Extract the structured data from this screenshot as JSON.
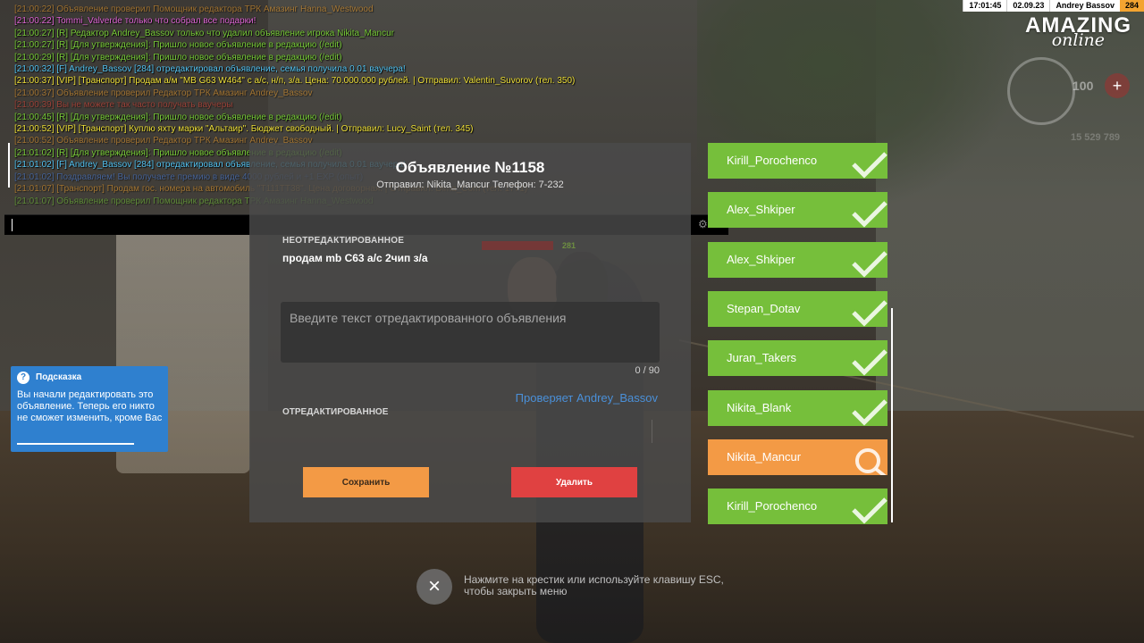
{
  "chat": [
    {
      "text": "[21:00:22] Объявление проверил Помощник редактора ТРК Амазинг Hanna_Westwood",
      "color": "#f4a431",
      "dim": true
    },
    {
      "text": "[21:00:22] Tommi_Valverde только что собрал все подарки!",
      "color": "#e36ad9",
      "dim": false
    },
    {
      "text": "[21:00:27] [R] Редактор Andrey_Bassov только что удалил объявление игрока Nikita_Mancur",
      "color": "#7ccf3c",
      "dim": false
    },
    {
      "text": "[21:00:27] [R] [Для утверждения]: Пришло новое объявление в редакцию (/edit)",
      "color": "#7ccf3c",
      "dim": false
    },
    {
      "text": "[21:00:29] [R] [Для утверждения]: Пришло новое объявление в редакцию (/edit)",
      "color": "#7ccf3c",
      "dim": false
    },
    {
      "text": "[21:00:32] [F] Andrey_Bassov [284] отредактировал объявление, семья получила 0.01 ваучера!",
      "color": "#58c7f5",
      "dim": false
    },
    {
      "text": "[21:00:37] [VIP] [Транспорт] Продам а/м \"MB G63 W464\" с а/с, н/п, з/а. Цена: 70.000.000 рублей. | Отправил: Valentin_Suvorov (тел. 350)",
      "color": "#f2e33c",
      "dim": false
    },
    {
      "text": "[21:00:37] Объявление проверил Редактор ТРК Амазинг Andrey_Bassov",
      "color": "#f4a431",
      "dim": true
    },
    {
      "text": "[21:00:39] Вы не можете так часто получать ваучеры",
      "color": "#e84a3c",
      "dim": true
    },
    {
      "text": "[21:00:45] [R] [Для утверждения]: Пришло новое объявление в редакцию (/edit)",
      "color": "#7ccf3c",
      "dim": false
    },
    {
      "text": "[21:00:52] [VIP] [Транспорт] Куплю яхту марки \"Альтаир\". Бюджет свободный. | Отправил: Lucy_Saint (тел. 345)",
      "color": "#f2e33c",
      "dim": false
    },
    {
      "text": "[21:00:52] Объявление проверил Редактор ТРК Амазинг Andrey_Bassov",
      "color": "#f4a431",
      "dim": true
    },
    {
      "text": "[21:01:02] [R] [Для утверждения]: Пришло новое объявление в редакцию (/edit)",
      "color": "#7ccf3c",
      "dim": false
    },
    {
      "text": "[21:01:02] [F] Andrey_Bassov [284] отредактировал объявление, семья получила 0.01 ваучера!",
      "color": "#58c7f5",
      "dim": false
    },
    {
      "text": "[21:01:02] Поздравляем! Вы получаете премию в виде 4000 рублей и +1 EXP (опыт)",
      "color": "#4f86e8",
      "dim": true
    },
    {
      "text": "[21:01:07] [Транспорт] Продам гос. номера на автомобиль \"Т111ТТ38\". Цена договорная. | Отправил: Dima_Com (тел. 1771)",
      "color": "#f4a431",
      "dim": true
    },
    {
      "text": "[21:01:07] Объявление проверил Помощник редактора ТРК Амазинг Hanna_Westwood",
      "color": "#7ccf3c",
      "dim": true
    }
  ],
  "chat_input": {
    "lang": "RU",
    "gear_icon": "gear-icon"
  },
  "hud": {
    "time": "17:01:45",
    "date": "02.09.23",
    "player": "Andrey Bassov",
    "id": "284",
    "logo_main": "AMAZING",
    "logo_sub": "online",
    "hp": "100",
    "plus": "+",
    "money": "15 529 789"
  },
  "hint": {
    "title": "Подсказка",
    "text": "Вы начали редактировать это объявление. Теперь его никто не сможет изменить, кроме Вас",
    "icon": "?"
  },
  "modal": {
    "title": "Объявление №1158",
    "subtitle": "Отправил: Nikita_Mancur Телефон: 7-232",
    "label_original": "НЕОТРЕДАКТИРОВАННОЕ",
    "original_text": "продам mb C63 а/с 2чип з/а",
    "placeholder": "Введите текст отредактированного объявления",
    "counter": "0 / 90",
    "checker": "Проверяет Andrey_Bassov",
    "label_edited": "ОТРЕДАКТИРОВАННОЕ",
    "save_label": "Сохранить",
    "delete_label": "Удалить",
    "hp_num": "281"
  },
  "editors": [
    {
      "name": "Kirill_Porochenco",
      "status": "done"
    },
    {
      "name": "Alex_Shkiper",
      "status": "done"
    },
    {
      "name": "Alex_Shkiper",
      "status": "done"
    },
    {
      "name": "Stepan_Dotav",
      "status": "done"
    },
    {
      "name": "Juran_Takers",
      "status": "done"
    },
    {
      "name": "Nikita_Blank",
      "status": "done"
    },
    {
      "name": "Nikita_Mancur",
      "status": "active"
    },
    {
      "name": "Kirill_Porochenco",
      "status": "done"
    }
  ],
  "close": {
    "hint": "Нажмите на крестик или используйте клавишу ESC, чтобы закрыть меню",
    "icon": "×"
  },
  "colors": {
    "done": "#76bf3b",
    "active": "#f39a45",
    "delete": "#e04141",
    "hint_bg": "#2f80cf"
  }
}
